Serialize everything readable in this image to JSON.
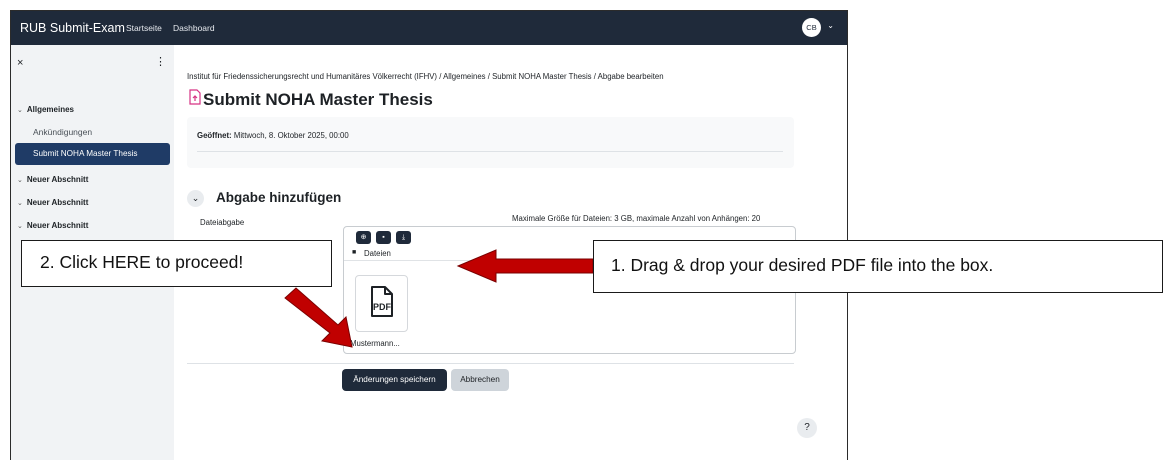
{
  "navbar": {
    "brand": "RUB Submit-Exam",
    "links": [
      "Startseite",
      "Dashboard"
    ],
    "avatar_initials": "CB",
    "bg_color": "#1f2a3a"
  },
  "sidebar": {
    "close_icon": "×",
    "menu_icon": "⋮",
    "sections": [
      {
        "label": "Allgemeines",
        "items": [
          "Ankündigungen",
          "Submit NOHA Master Thesis"
        ]
      },
      {
        "label": "Neuer Abschnitt"
      },
      {
        "label": "Neuer Abschnitt"
      },
      {
        "label": "Neuer Abschnitt"
      }
    ],
    "active_item": "Submit NOHA Master Thesis"
  },
  "breadcrumb": "Institut für Friedenssicherungsrecht und Humanitäres Völkerrecht (IFHV)  /  Allgemeines  /  Submit NOHA Master Thesis  /  Abgabe bearbeiten",
  "page_title": "Submit NOHA Master Thesis",
  "opened": {
    "label": "Geöffnet:",
    "value": "Mittwoch, 8. Oktober 2025, 00:00"
  },
  "submission": {
    "section_title": "Abgabe hinzufügen",
    "file_label": "Dateiabgabe",
    "max_info": "Maximale Größe für Dateien: 3 GB, maximale Anzahl von Anhängen: 20",
    "folder_label": "Dateien",
    "file_type": "PDF",
    "file_name": "Mustermann...",
    "icons": [
      "add-file-icon",
      "folder-icon",
      "download-icon"
    ]
  },
  "buttons": {
    "save": "Änderungen speichern",
    "cancel": "Abbrechen",
    "help": "?"
  },
  "annotations": {
    "left": "2. Click HERE to proceed!",
    "right": "1. Drag & drop your desired PDF file into the box.",
    "arrow_color": "#c00000"
  }
}
